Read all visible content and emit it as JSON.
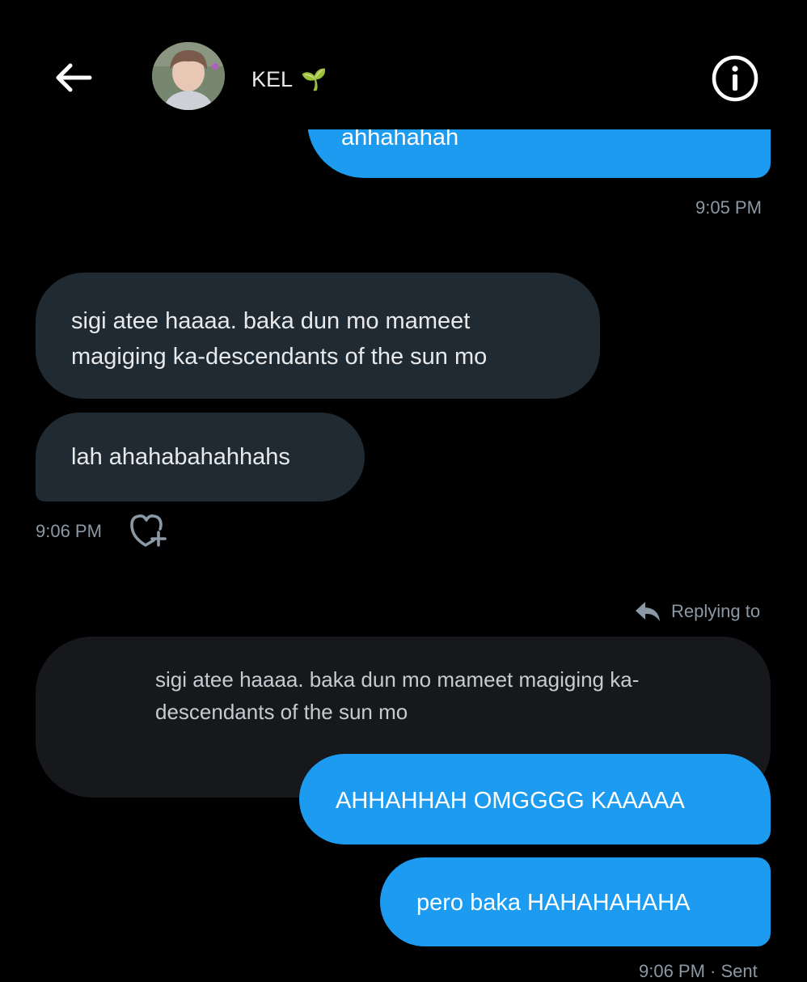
{
  "header": {
    "contact_name": "KEL",
    "contact_emoji": "🌱",
    "back_icon": "back-arrow-icon",
    "info_icon": "info-icon"
  },
  "messages": {
    "clipped_sent_text": "ahhahahah",
    "time_1": "9:05 PM",
    "recv_1": "sigi atee haaaa. baka dun mo mameet magiging ka-descendants of the sun mo",
    "recv_2": "lah ahahabahahhahs",
    "time_2": "9:06 PM",
    "replying_label": "Replying to",
    "quoted_text": "sigi atee haaaa. baka dun mo mameet magiging ka-descendants of the sun mo",
    "sent_2": "AHHAHHAH OMGGGG KAAAAA",
    "sent_3": "pero baka HAHAHAHAHA",
    "time_3": "9:06 PM · Sent"
  },
  "colors": {
    "sent_bubble": "#1d9bf0",
    "received_bubble": "#1f2a33",
    "background": "#000000"
  }
}
